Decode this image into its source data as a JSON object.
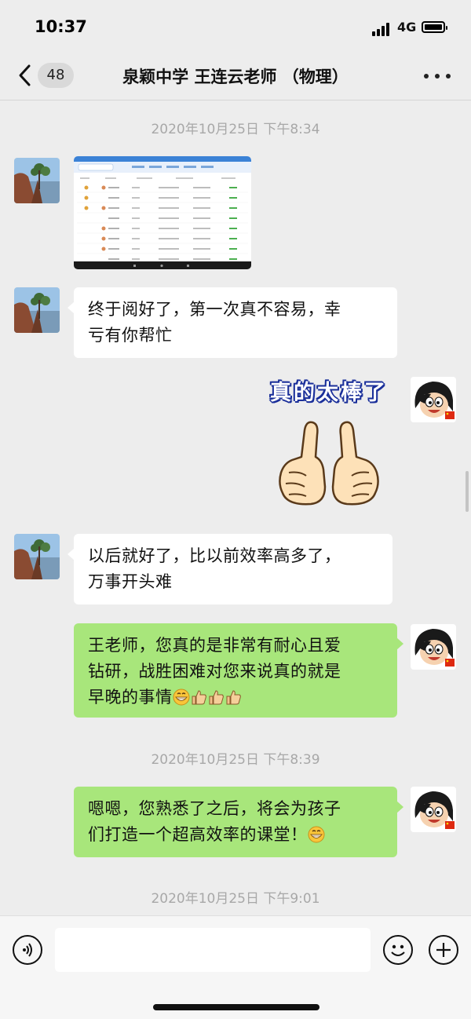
{
  "status_bar": {
    "time": "10:37",
    "network": "4G"
  },
  "nav": {
    "unread_count": "48",
    "title": "泉颖中学 王连云老师 （物理）"
  },
  "timestamps": [
    "2020年10月25日 下午8:34",
    "2020年10月25日 下午8:39",
    "2020年10月25日 下午9:01"
  ],
  "messages": [
    {
      "side": "left",
      "type": "image",
      "content": "screenshot-of-table"
    },
    {
      "side": "left",
      "type": "text",
      "lines": [
        "终于阅好了，第一次真不容易，幸",
        "亏有你帮忙"
      ]
    },
    {
      "side": "right",
      "type": "sticker",
      "text": "真的太棒了",
      "content": "thumbs-up-hands"
    },
    {
      "side": "left",
      "type": "text",
      "lines": [
        "以后就好了，比以前效率高多了，",
        "万事开头难"
      ]
    },
    {
      "side": "right",
      "type": "text",
      "lines": [
        "王老师，您真的是非常有耐心且爱",
        "钻研，战胜困难对您来说真的就是",
        "早晚的事情"
      ],
      "trailing_emoji": [
        "grin-emoji",
        "thumbs-up-emoji",
        "thumbs-up-emoji",
        "thumbs-up-emoji"
      ]
    },
    {
      "side": "right",
      "type": "text",
      "lines": [
        "嗯嗯，您熟悉了之后，将会为孩子",
        "们打造一个超高效率的课堂！"
      ],
      "trailing_emoji": [
        "grin-emoji"
      ]
    }
  ],
  "input_bar": {
    "voice_icon": "voice-icon",
    "emoji_icon": "smiley-icon",
    "plus_icon": "plus-icon"
  },
  "colors": {
    "background": "#ededed",
    "bubble_out": "#a8e67b",
    "bubble_in": "#ffffff"
  }
}
